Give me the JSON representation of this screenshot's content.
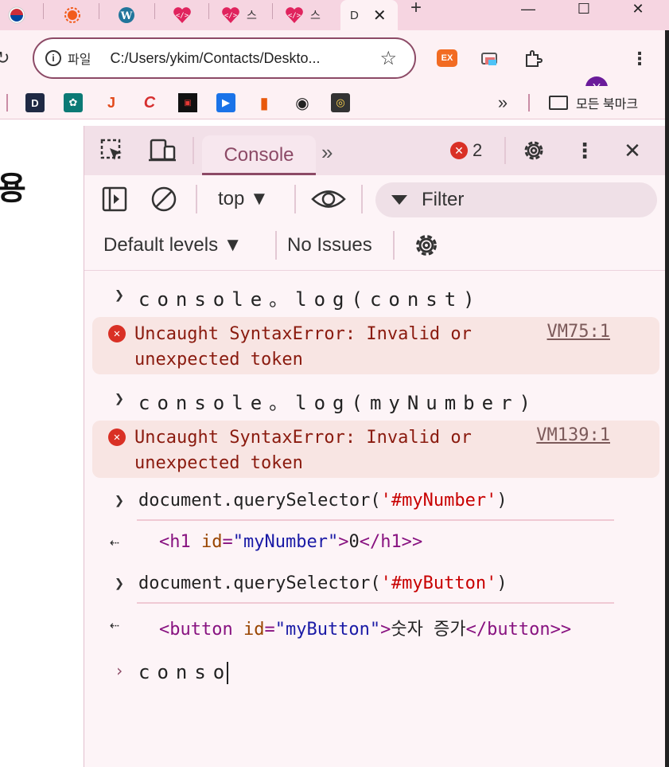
{
  "tabs": {
    "active_title": "D",
    "partial_title_1": "스",
    "partial_title_2": "스"
  },
  "window": {
    "minimize": "—",
    "maximize": "☐",
    "close": "✕",
    "new_tab": "+"
  },
  "address_bar": {
    "scheme_label": "파일",
    "url": "C:/Users/ykim/Contacts/Deskto...",
    "extension_label": "EX",
    "avatar_letter": "Y"
  },
  "bookmarks": {
    "items": [
      {
        "glyph": "D",
        "color": "#1f2a44"
      },
      {
        "glyph": "✿",
        "color": "#0b7a75"
      },
      {
        "glyph": "J",
        "color": "#e24a1b"
      },
      {
        "glyph": "C",
        "color": "#d62f2f"
      },
      {
        "glyph": "▣",
        "color": "#111111"
      },
      {
        "glyph": "▶",
        "color": "#1a73e8"
      },
      {
        "glyph": "▮",
        "color": "#e8590c"
      },
      {
        "glyph": "◉",
        "color": "#222222"
      },
      {
        "glyph": "◎",
        "color": "#444444"
      }
    ],
    "overflow": "»",
    "folder_label": "모든 북마크"
  },
  "page": {
    "heading_fragment": "용"
  },
  "devtools": {
    "active_tab": "Console",
    "more_tabs": "»",
    "error_count": "2",
    "context": "top ▼",
    "filter_placeholder": "Filter",
    "levels": "Default levels ▼",
    "issues": "No Issues"
  },
  "console": {
    "entries": [
      {
        "type": "input",
        "text": "console。log(const)"
      },
      {
        "type": "error",
        "message": "Uncaught SyntaxError: Invalid or unexpected token",
        "source": "VM75:1"
      },
      {
        "type": "input",
        "text": "console。log(myNumber)"
      },
      {
        "type": "error",
        "message": "Uncaught SyntaxError: Invalid or unexpected token",
        "source": "VM139:1"
      },
      {
        "type": "input",
        "prefix": "document.querySelector(",
        "arg": "'#myNumber'",
        "suffix": ")"
      },
      {
        "type": "return",
        "open_tag": "<h1",
        "attr_name": "id",
        "attr_value": "\"myNumber\"",
        "content": "0",
        "close_tag": "</h1>"
      },
      {
        "type": "input",
        "prefix": "document.querySelector(",
        "arg": "'#myButton'",
        "suffix": ")"
      },
      {
        "type": "return",
        "open_tag": "<button",
        "attr_name": "id",
        "attr_value": "\"myButton\"",
        "content": "숫자 증가",
        "close_tag": "</button>"
      }
    ],
    "current_input": "conso"
  },
  "colors": {
    "accent": "#8c4a66",
    "tabstrip": "#f6d5e1",
    "error_bg": "#f8e5e3",
    "error_text": "#8a1a0e",
    "error_icon": "#d93025"
  }
}
